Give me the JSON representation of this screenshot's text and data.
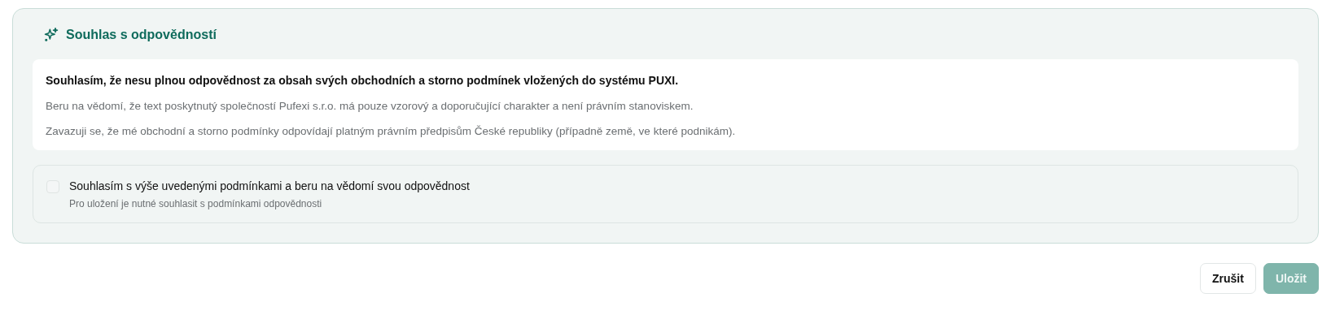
{
  "section": {
    "title": "Souhlas s odpovědností",
    "notice": {
      "heading": "Souhlasím, že nesu plnou odpovědnost za obsah svých obchodních a storno podmínek vložených do systému PUXI.",
      "paragraphs": [
        "Beru na vědomí, že text poskytnutý společností Pufexi s.r.o. má pouze vzorový a doporučující charakter a není právním stanoviskem.",
        "Zavazuji se, že mé obchodní a storno podmínky odpovídají platným právním předpisům České republiky (případně země, ve které podnikám)."
      ]
    },
    "agreement": {
      "label": "Souhlasím s výše uvedenými podmínkami a beru na vědomí svou odpovědnost",
      "hint": "Pro uložení je nutné souhlasit s podmínkami odpovědnosti",
      "checked": false
    }
  },
  "buttons": [
    {
      "kind": "cancel",
      "label": "Zrušit",
      "disabled": false
    },
    {
      "kind": "save",
      "label": "Uložit",
      "disabled": true
    }
  ]
}
